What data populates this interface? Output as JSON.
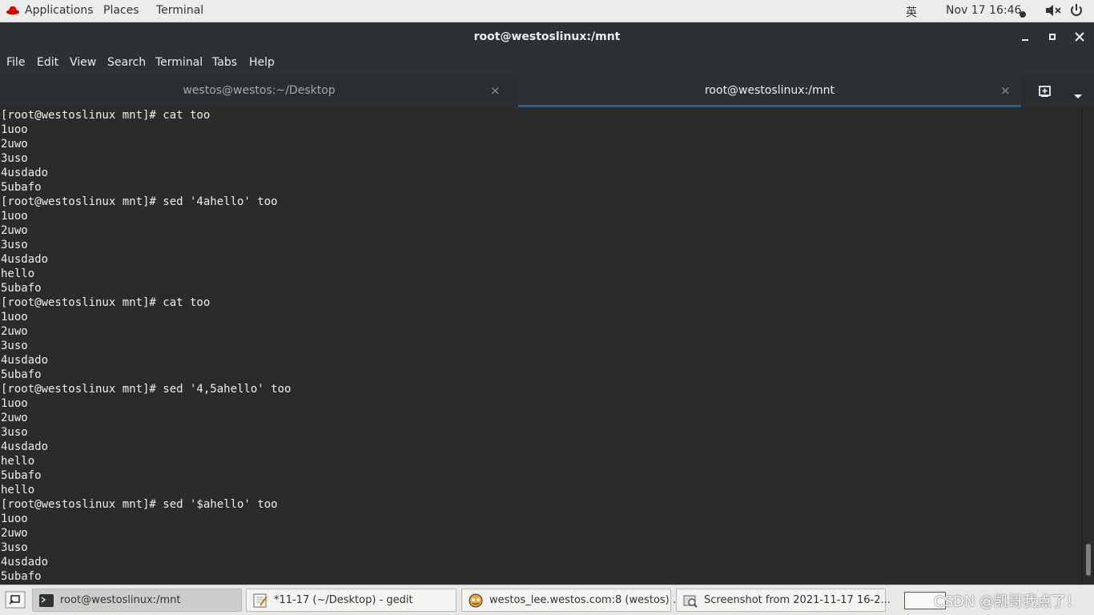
{
  "topbar": {
    "applications": "Applications",
    "places": "Places",
    "terminal": "Terminal",
    "input_method": "英",
    "clock": "Nov 17  16:46"
  },
  "window": {
    "title": "root@westoslinux:/mnt"
  },
  "menu": [
    "File",
    "Edit",
    "View",
    "Search",
    "Terminal",
    "Tabs",
    "Help"
  ],
  "tabs": [
    {
      "label": "westos@westos:~/Desktop",
      "close": "×"
    },
    {
      "label": "root@westoslinux:/mnt",
      "close": "×"
    }
  ],
  "terminal_lines": [
    "[root@westoslinux mnt]# cat too",
    "1uoo",
    "2uwo",
    "3uso",
    "4usdado",
    "5ubafo",
    "[root@westoslinux mnt]# sed '4ahello' too",
    "1uoo",
    "2uwo",
    "3uso",
    "4usdado",
    "hello",
    "5ubafo",
    "[root@westoslinux mnt]# cat too",
    "1uoo",
    "2uwo",
    "3uso",
    "4usdado",
    "5ubafo",
    "[root@westoslinux mnt]# sed '4,5ahello' too",
    "1uoo",
    "2uwo",
    "3uso",
    "4usdado",
    "hello",
    "5ubafo",
    "hello",
    "[root@westoslinux mnt]# sed '$ahello' too",
    "1uoo",
    "2uwo",
    "3uso",
    "4usdado",
    "5ubafo"
  ],
  "taskbar": {
    "tasks": [
      {
        "label": "root@westoslinux:/mnt",
        "icon": "terminal-icon"
      },
      {
        "label": "*11-17 (~/Desktop) - gedit",
        "icon": "gedit-icon"
      },
      {
        "label": "westos_lee.westos.com:8 (westos) ...",
        "icon": "vnc-viewer-icon"
      },
      {
        "label": "Screenshot from 2021-11-17 16-2...",
        "icon": "screenshot-icon"
      }
    ],
    "watermark": "CSDN @凯哥我点了！"
  },
  "colors": {
    "terminal_bg": "#2b2b2b",
    "terminal_fg": "#eeeeec",
    "tab_active_underline": "#215d9c",
    "titlebar_bg": "#2d3133"
  }
}
